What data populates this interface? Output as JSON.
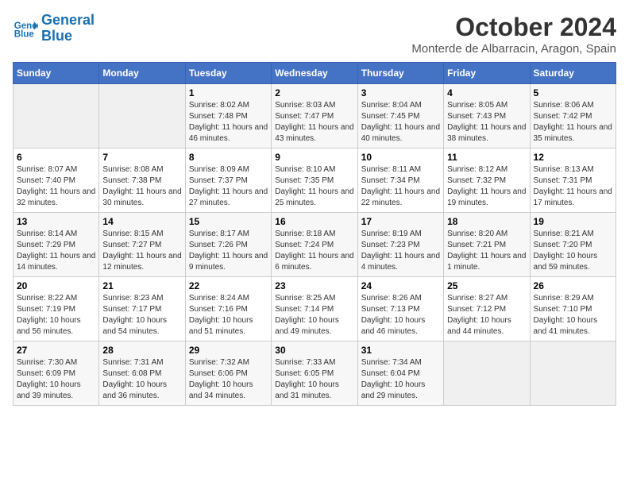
{
  "header": {
    "logo_line1": "General",
    "logo_line2": "Blue",
    "month_title": "October 2024",
    "location": "Monterde de Albarracin, Aragon, Spain"
  },
  "weekdays": [
    "Sunday",
    "Monday",
    "Tuesday",
    "Wednesday",
    "Thursday",
    "Friday",
    "Saturday"
  ],
  "weeks": [
    [
      {
        "day": "",
        "info": ""
      },
      {
        "day": "",
        "info": ""
      },
      {
        "day": "1",
        "info": "Sunrise: 8:02 AM\nSunset: 7:48 PM\nDaylight: 11 hours and 46 minutes."
      },
      {
        "day": "2",
        "info": "Sunrise: 8:03 AM\nSunset: 7:47 PM\nDaylight: 11 hours and 43 minutes."
      },
      {
        "day": "3",
        "info": "Sunrise: 8:04 AM\nSunset: 7:45 PM\nDaylight: 11 hours and 40 minutes."
      },
      {
        "day": "4",
        "info": "Sunrise: 8:05 AM\nSunset: 7:43 PM\nDaylight: 11 hours and 38 minutes."
      },
      {
        "day": "5",
        "info": "Sunrise: 8:06 AM\nSunset: 7:42 PM\nDaylight: 11 hours and 35 minutes."
      }
    ],
    [
      {
        "day": "6",
        "info": "Sunrise: 8:07 AM\nSunset: 7:40 PM\nDaylight: 11 hours and 32 minutes."
      },
      {
        "day": "7",
        "info": "Sunrise: 8:08 AM\nSunset: 7:38 PM\nDaylight: 11 hours and 30 minutes."
      },
      {
        "day": "8",
        "info": "Sunrise: 8:09 AM\nSunset: 7:37 PM\nDaylight: 11 hours and 27 minutes."
      },
      {
        "day": "9",
        "info": "Sunrise: 8:10 AM\nSunset: 7:35 PM\nDaylight: 11 hours and 25 minutes."
      },
      {
        "day": "10",
        "info": "Sunrise: 8:11 AM\nSunset: 7:34 PM\nDaylight: 11 hours and 22 minutes."
      },
      {
        "day": "11",
        "info": "Sunrise: 8:12 AM\nSunset: 7:32 PM\nDaylight: 11 hours and 19 minutes."
      },
      {
        "day": "12",
        "info": "Sunrise: 8:13 AM\nSunset: 7:31 PM\nDaylight: 11 hours and 17 minutes."
      }
    ],
    [
      {
        "day": "13",
        "info": "Sunrise: 8:14 AM\nSunset: 7:29 PM\nDaylight: 11 hours and 14 minutes."
      },
      {
        "day": "14",
        "info": "Sunrise: 8:15 AM\nSunset: 7:27 PM\nDaylight: 11 hours and 12 minutes."
      },
      {
        "day": "15",
        "info": "Sunrise: 8:17 AM\nSunset: 7:26 PM\nDaylight: 11 hours and 9 minutes."
      },
      {
        "day": "16",
        "info": "Sunrise: 8:18 AM\nSunset: 7:24 PM\nDaylight: 11 hours and 6 minutes."
      },
      {
        "day": "17",
        "info": "Sunrise: 8:19 AM\nSunset: 7:23 PM\nDaylight: 11 hours and 4 minutes."
      },
      {
        "day": "18",
        "info": "Sunrise: 8:20 AM\nSunset: 7:21 PM\nDaylight: 11 hours and 1 minute."
      },
      {
        "day": "19",
        "info": "Sunrise: 8:21 AM\nSunset: 7:20 PM\nDaylight: 10 hours and 59 minutes."
      }
    ],
    [
      {
        "day": "20",
        "info": "Sunrise: 8:22 AM\nSunset: 7:19 PM\nDaylight: 10 hours and 56 minutes."
      },
      {
        "day": "21",
        "info": "Sunrise: 8:23 AM\nSunset: 7:17 PM\nDaylight: 10 hours and 54 minutes."
      },
      {
        "day": "22",
        "info": "Sunrise: 8:24 AM\nSunset: 7:16 PM\nDaylight: 10 hours and 51 minutes."
      },
      {
        "day": "23",
        "info": "Sunrise: 8:25 AM\nSunset: 7:14 PM\nDaylight: 10 hours and 49 minutes."
      },
      {
        "day": "24",
        "info": "Sunrise: 8:26 AM\nSunset: 7:13 PM\nDaylight: 10 hours and 46 minutes."
      },
      {
        "day": "25",
        "info": "Sunrise: 8:27 AM\nSunset: 7:12 PM\nDaylight: 10 hours and 44 minutes."
      },
      {
        "day": "26",
        "info": "Sunrise: 8:29 AM\nSunset: 7:10 PM\nDaylight: 10 hours and 41 minutes."
      }
    ],
    [
      {
        "day": "27",
        "info": "Sunrise: 7:30 AM\nSunset: 6:09 PM\nDaylight: 10 hours and 39 minutes."
      },
      {
        "day": "28",
        "info": "Sunrise: 7:31 AM\nSunset: 6:08 PM\nDaylight: 10 hours and 36 minutes."
      },
      {
        "day": "29",
        "info": "Sunrise: 7:32 AM\nSunset: 6:06 PM\nDaylight: 10 hours and 34 minutes."
      },
      {
        "day": "30",
        "info": "Sunrise: 7:33 AM\nSunset: 6:05 PM\nDaylight: 10 hours and 31 minutes."
      },
      {
        "day": "31",
        "info": "Sunrise: 7:34 AM\nSunset: 6:04 PM\nDaylight: 10 hours and 29 minutes."
      },
      {
        "day": "",
        "info": ""
      },
      {
        "day": "",
        "info": ""
      }
    ]
  ]
}
